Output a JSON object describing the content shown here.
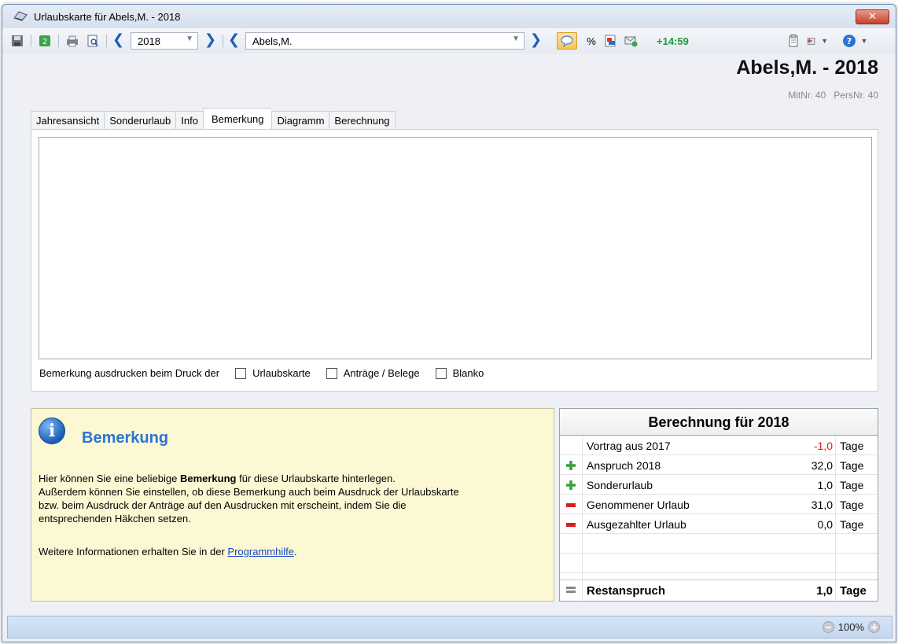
{
  "window": {
    "title": "Urlaubskarte für Abels,M. - 2018",
    "close_label": "✕"
  },
  "toolbar": {
    "year_value": "2018",
    "employee_value": "Abels,M.",
    "time_badge": "+14:59"
  },
  "header": {
    "title": "Abels,M. - 2018",
    "mitnr": "MitNr. 40",
    "persnr": "PersNr. 40"
  },
  "tabs": [
    {
      "label": "Jahresansicht"
    },
    {
      "label": "Sonderurlaub"
    },
    {
      "label": "Info"
    },
    {
      "label": "Bemerkung"
    },
    {
      "label": "Diagramm"
    },
    {
      "label": "Berechnung"
    }
  ],
  "remark": {
    "text": "",
    "print_label": "Bemerkung ausdrucken beim Druck der",
    "opt_urlaubskarte": "Urlaubskarte",
    "opt_antraege": "Anträge / Belege",
    "opt_blanko": "Blanko"
  },
  "info": {
    "title": "Bemerkung",
    "line1_pre": "Hier können Sie eine beliebige ",
    "line1_bold": "Bemerkung",
    "line1_post": " für diese Urlaubskarte hinterlegen.",
    "line2": "Außerdem können Sie einstellen, ob diese Bemerkung auch beim Ausdruck der Urlaubskarte",
    "line3": "bzw. beim Ausdruck der Anträge auf den Ausdrucken mit erscheint, indem Sie die",
    "line4": "entsprechenden Häkchen setzen.",
    "more_pre": "Weitere Informationen erhalten Sie in der ",
    "more_link": "Programmhilfe",
    "more_post": "."
  },
  "calc": {
    "title": "Berechnung für 2018",
    "rows": [
      {
        "icon": "none",
        "label": "Vortrag aus 2017",
        "value": "-1,0",
        "unit": "Tage",
        "value_color": "#e02020"
      },
      {
        "icon": "plus-icon",
        "label": "Anspruch 2018",
        "value": "32,0",
        "unit": "Tage"
      },
      {
        "icon": "plus-icon",
        "label": "Sonderurlaub",
        "value": "1,0",
        "unit": "Tage"
      },
      {
        "icon": "minus-icon",
        "label": "Genommener Urlaub",
        "value": "31,0",
        "unit": "Tage"
      },
      {
        "icon": "minus-icon",
        "label": "Ausgezahlter Urlaub",
        "value": "0,0",
        "unit": "Tage"
      }
    ],
    "total": {
      "icon": "equals-icon",
      "label": "Restanspruch",
      "value": "1,0",
      "unit": "Tage"
    }
  },
  "status": {
    "zoom": "100%"
  },
  "colors": {
    "accent": "#2a74d6",
    "info_bg": "#fbf8d3",
    "negative": "#e02020",
    "time": "#1c9a3e"
  }
}
